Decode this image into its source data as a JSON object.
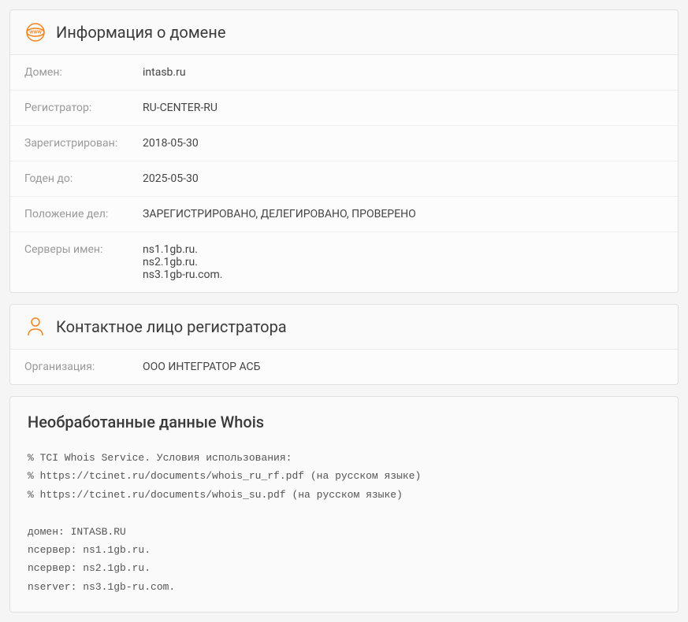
{
  "domain_info": {
    "title": "Информация о домене",
    "rows": {
      "domain_label": "Домен:",
      "domain_value": "intasb.ru",
      "registrar_label": "Регистратор:",
      "registrar_value": "RU-CENTER-RU",
      "registered_label": "Зарегистрирован:",
      "registered_value": "2018-05-30",
      "valid_until_label": "Годен до:",
      "valid_until_value": "2025-05-30",
      "status_label": "Положение дел:",
      "status_value": "ЗАРЕГИСТРИРОВАНО, ДЕЛЕГИРОВАНО, ПРОВЕРЕНО",
      "servers_label": "Серверы имен:",
      "servers_value": "ns1.1gb.ru.\nns2.1gb.ru.\nns3.1gb-ru.com."
    }
  },
  "contact": {
    "title": "Контактное лицо регистратора",
    "org_label": "Организация:",
    "org_value": "ООО ИНТЕГРАТОР АСБ"
  },
  "raw": {
    "title": "Необработанные данные Whois",
    "text": "% TCI Whois Service. Условия использования:\n% https://tcinet.ru/documents/whois_ru_rf.pdf (на русском языке)\n% https://tcinet.ru/documents/whois_su.pdf (на русском языке)\n\nдомен: INTASB.RU\nnсервер: ns1.1gb.ru.\nnсервер: ns2.1gb.ru.\nnserver: ns3.1gb-ru.com."
  }
}
